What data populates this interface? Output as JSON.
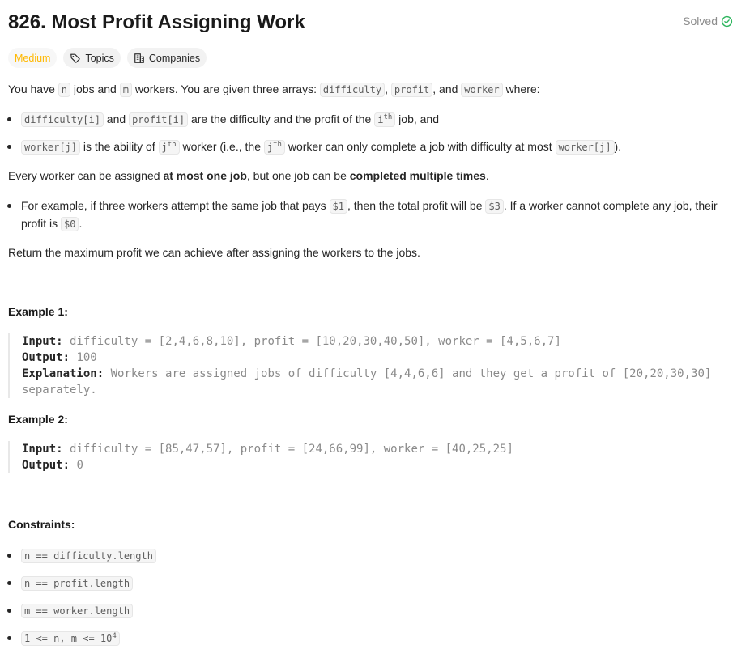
{
  "header": {
    "title": "826. Most Profit Assigning Work",
    "status": "Solved"
  },
  "tags": [
    {
      "label": "Medium"
    },
    {
      "label": "Topics",
      "icon": "tag-icon"
    },
    {
      "label": "Companies",
      "icon": "building-icon"
    }
  ],
  "intro": {
    "t1": "You have ",
    "n": "n",
    "t2": " jobs and ",
    "m": "m",
    "t3": " workers. You are given three arrays: ",
    "a1": "difficulty",
    "c1": ", ",
    "a2": "profit",
    "c2": ", and ",
    "a3": "worker",
    "t4": " where:"
  },
  "bullets1": [
    {
      "code1": "difficulty[i]",
      "t1": " and ",
      "code2": "profit[i]",
      "t2": " are the difficulty and the profit of the ",
      "code3": "i",
      "sup": "th",
      "t3": " job, and"
    },
    {
      "code1": "worker[j]",
      "t1": " is the ability of ",
      "code2": "j",
      "sup1": "th",
      "t2": " worker (i.e., the ",
      "code3": "j",
      "sup2": "th",
      "t3": " worker can only complete a job with difficulty at most ",
      "code4": "worker[j]",
      "t4": ")."
    }
  ],
  "rule": {
    "t1": "Every worker can be assigned ",
    "b1": "at most one job",
    "t2": ", but one job can be ",
    "b2": "completed multiple times",
    "t3": "."
  },
  "example_bullet": {
    "t1": "For example, if three workers attempt the same job that pays ",
    "c1": "$1",
    "t2": ", then the total profit will be ",
    "c2": "$3",
    "t3": ". If a worker cannot complete any job, their profit is ",
    "c3": "$0",
    "t4": "."
  },
  "return_text": "Return the maximum profit we can achieve after assigning the workers to the jobs.",
  "examples": [
    {
      "heading": "Example 1:",
      "input_label": "Input:",
      "input": " difficulty = [2,4,6,8,10], profit = [10,20,30,40,50], worker = [4,5,6,7]",
      "output_label": "Output:",
      "output": " 100",
      "explanation_label": "Explanation:",
      "explanation_line1": " Workers are assigned jobs of difficulty [4,4,6,6] and they get a profit of [20,20,30,30]",
      "explanation_line2": "separately."
    },
    {
      "heading": "Example 2:",
      "input_label": "Input:",
      "input": " difficulty = [85,47,57], profit = [24,66,99], worker = [40,25,25]",
      "output_label": "Output:",
      "output": " 0"
    }
  ],
  "constraints": {
    "heading": "Constraints:",
    "items": [
      "n == difficulty.length",
      "n == profit.length",
      "m == worker.length"
    ],
    "last_base": "1 <= n, m <= 10",
    "last_sup": "4"
  }
}
